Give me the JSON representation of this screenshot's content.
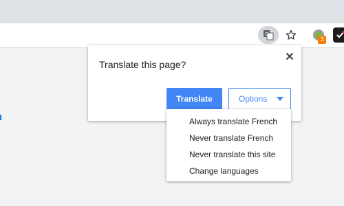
{
  "browser": {
    "extension_badge": "3"
  },
  "bubble": {
    "title": "Translate this page?",
    "translate_label": "Translate",
    "options_label": "Options"
  },
  "options_menu": {
    "items": [
      {
        "label": "Always translate French"
      },
      {
        "label": "Never translate French"
      },
      {
        "label": "Never translate this site"
      },
      {
        "label": "Change languages"
      }
    ]
  },
  "icons": {
    "translate": "translate-icon",
    "star": "star-icon",
    "close": "close-icon",
    "caret": "caret-down-icon"
  },
  "colors": {
    "accent": "#4285f4",
    "tabstrip": "#dee1e6",
    "page_bg": "#f1f3f4"
  }
}
